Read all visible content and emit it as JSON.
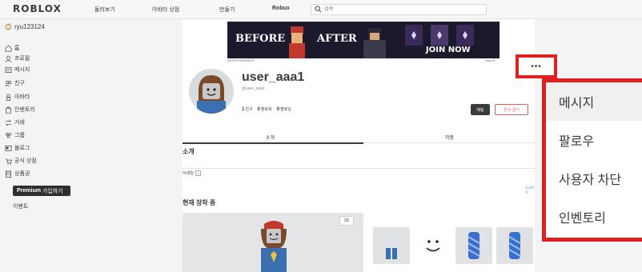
{
  "topbar": {
    "logo": "ROBLOX",
    "nav": [
      "둘러보기",
      "아바타 상점",
      "만들기",
      "Robux"
    ],
    "search_placeholder": "검색"
  },
  "sidebar": {
    "username": "ryu123124",
    "items": [
      {
        "label": "홈",
        "icon": "home-icon"
      },
      {
        "label": "프로필",
        "icon": "profile-icon"
      },
      {
        "label": "메시지",
        "icon": "message-icon"
      },
      {
        "label": "친구",
        "icon": "friends-icon"
      },
      {
        "label": "아바타",
        "icon": "avatar-icon"
      },
      {
        "label": "인벤토리",
        "icon": "inventory-icon"
      },
      {
        "label": "거래",
        "icon": "trade-icon"
      },
      {
        "label": "그룹",
        "icon": "groups-icon"
      },
      {
        "label": "블로그",
        "icon": "blog-icon"
      },
      {
        "label": "공식 상점",
        "icon": "shop-icon"
      },
      {
        "label": "상품권",
        "icon": "giftcard-icon"
      }
    ],
    "premium_bold": "Premium",
    "premium_rest": "가입하기",
    "events": "이벤트"
  },
  "ad": {
    "before": "BEFORE",
    "after": "AFTER",
    "join": "JOIN NOW",
    "label": "ADVERTISEMENT",
    "report": "Report"
  },
  "profile": {
    "username": "user_aaa1",
    "handle": "@user_aaa1",
    "friends_count": "1",
    "friends_label": "친구",
    "followers_count": "0",
    "followers_label": "팔로워",
    "following_count": "0",
    "following_label": "팔로잉",
    "chat_button": "채팅",
    "add_friend_button": "친구 걸기",
    "more_button": "•••"
  },
  "tabs": [
    "소개",
    "작품"
  ],
  "about": {
    "heading": "소개",
    "nickname_label": "닉네임",
    "report_link": "신고하기"
  },
  "wearing": {
    "heading": "현재 장착 중",
    "btn_3d": "3D"
  },
  "context_menu": {
    "items": [
      "메시지",
      "팔로우",
      "사용자 차단",
      "인벤토리"
    ]
  },
  "colors": {
    "highlight": "#e02020",
    "chat_bg": "#393b3d",
    "friend_outline": "#e25d5d"
  }
}
